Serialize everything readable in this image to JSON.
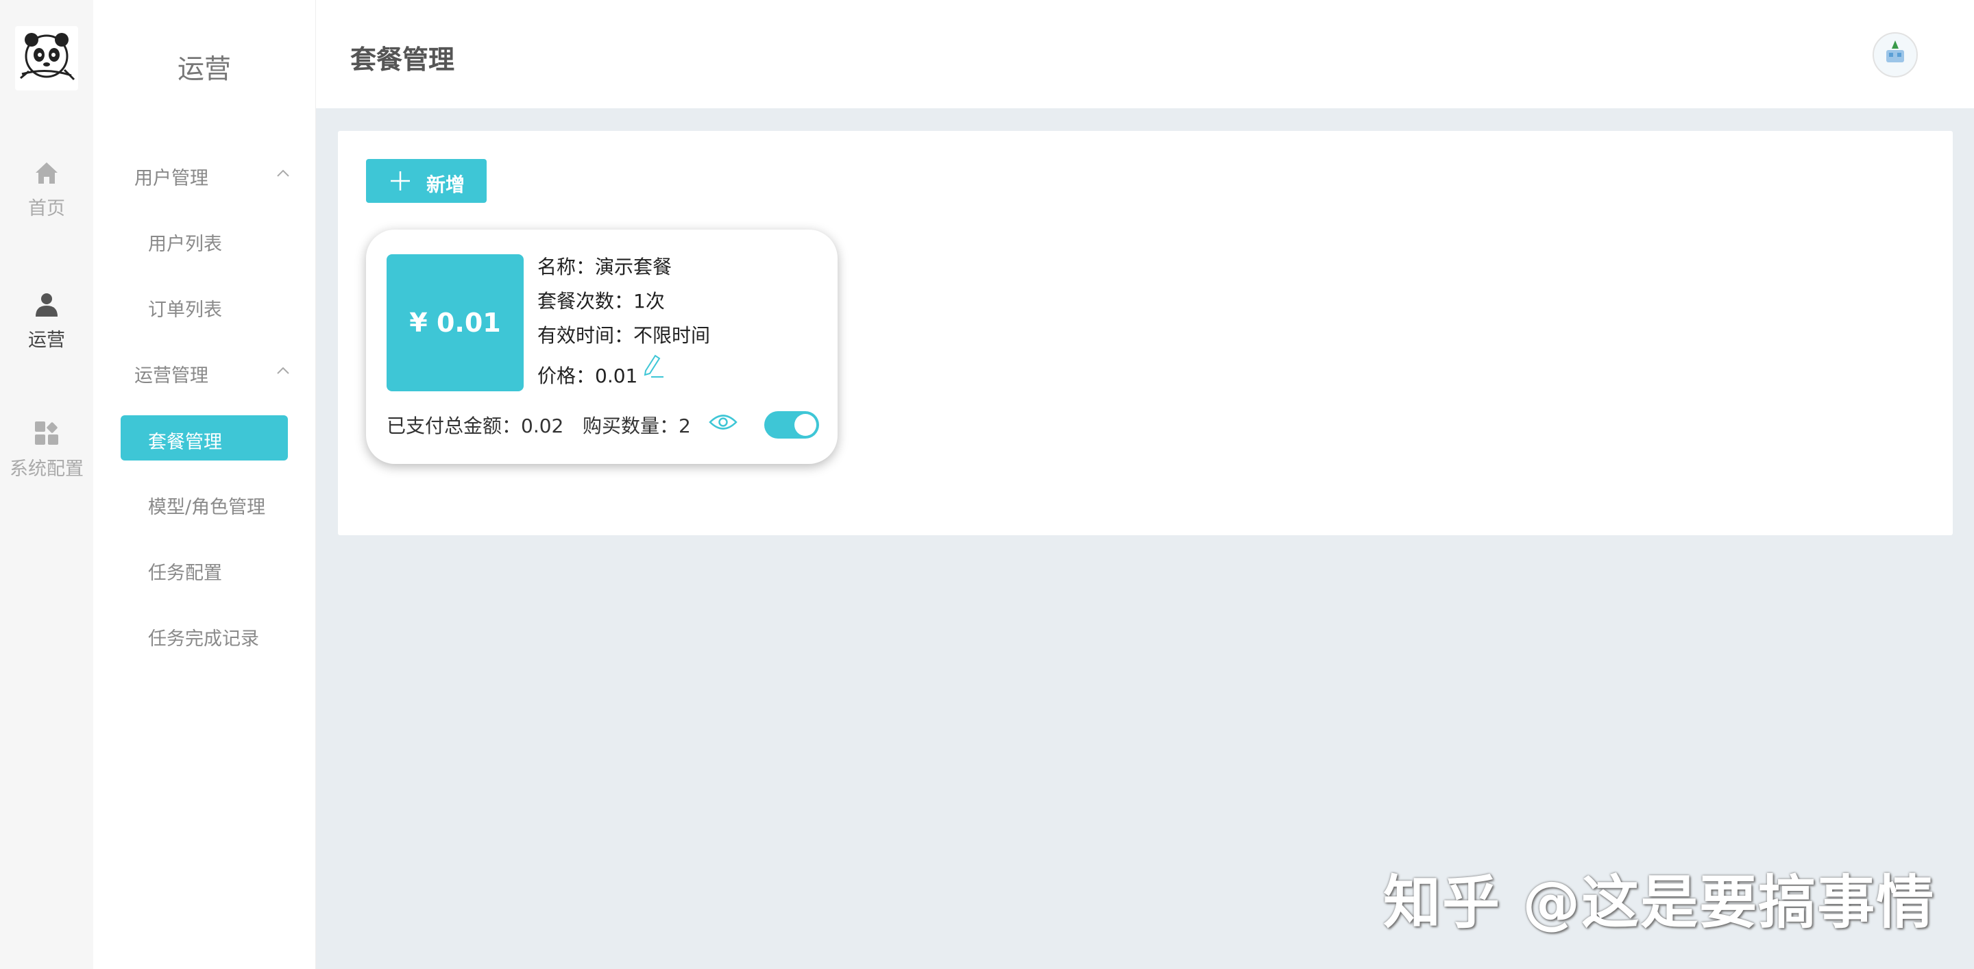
{
  "rail": {
    "items": [
      {
        "label": "首页",
        "icon": "home-icon"
      },
      {
        "label": "运营",
        "icon": "user-icon"
      },
      {
        "label": "系统配置",
        "icon": "apps-icon"
      }
    ]
  },
  "menu": {
    "title": "运营",
    "groups": [
      {
        "label": "用户管理",
        "items": [
          "用户列表",
          "订单列表"
        ]
      },
      {
        "label": "运营管理",
        "items": [
          "套餐管理",
          "模型/角色管理",
          "任务配置",
          "任务完成记录"
        ]
      }
    ],
    "active": "套餐管理"
  },
  "header": {
    "title": "套餐管理"
  },
  "content": {
    "add_label": "新增",
    "package": {
      "price_display": "¥ 0.01",
      "name_label": "名称：",
      "name_value": "演示套餐",
      "count_label": "套餐次数：",
      "count_value": "1次",
      "valid_label": "有效时间：",
      "valid_value": "不限时间",
      "price_label": "价格：",
      "price_value": "0.01",
      "paid_total_label": "已支付总金额：",
      "paid_total_value": "0.02",
      "purchase_count_label": "购买数量：",
      "purchase_count_value": "2",
      "enabled": true
    }
  },
  "watermark": "知乎 @这是要搞事情",
  "colors": {
    "accent": "#3ec6d6",
    "background": "#e8edf1"
  }
}
